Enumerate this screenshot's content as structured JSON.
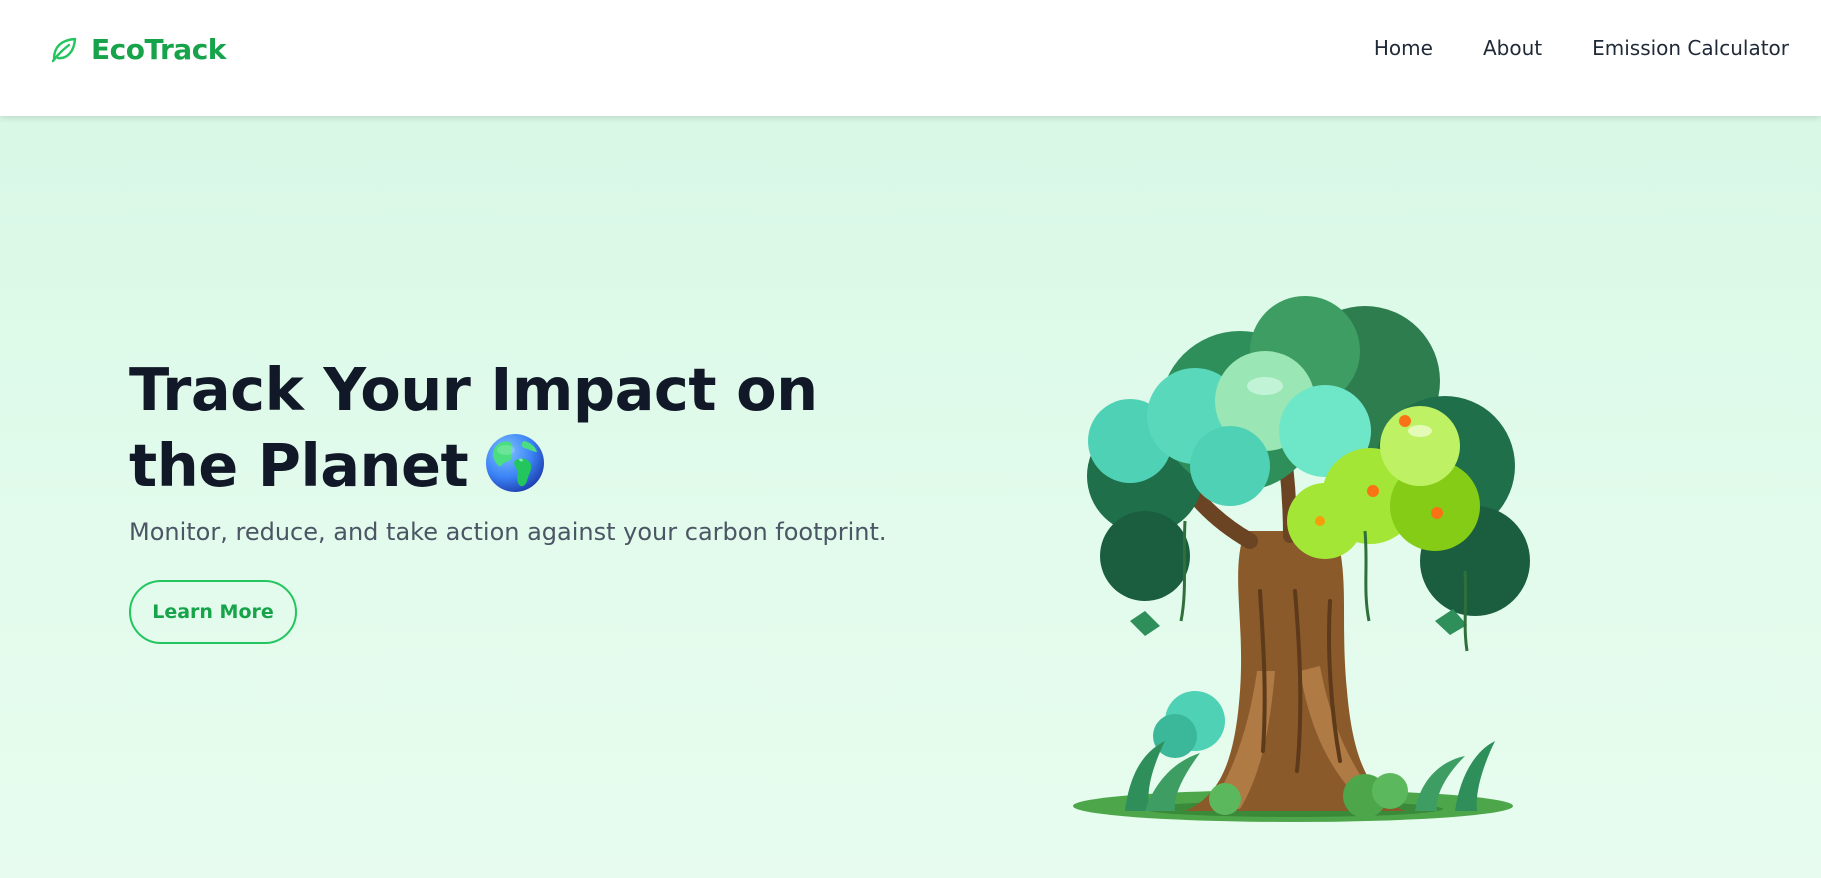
{
  "app": {
    "brand_name": "EcoTrack"
  },
  "nav": {
    "links": [
      {
        "label": "Home"
      },
      {
        "label": "About"
      },
      {
        "label": "Emission Calculator"
      }
    ]
  },
  "hero": {
    "headline": "Track Your Impact on the Planet",
    "subtitle": "Monitor, reduce, and take action against your carbon footprint.",
    "cta_label": "Learn More"
  },
  "colors": {
    "brand_green": "#16a34a",
    "button_border": "#22c55e",
    "hero_background": "#dcfce7",
    "headline_text": "#111827",
    "body_text": "#4b5563"
  },
  "icons": {
    "brand": "leaf-icon",
    "headline": "globe-icon",
    "illustration": "tree-illustration"
  }
}
